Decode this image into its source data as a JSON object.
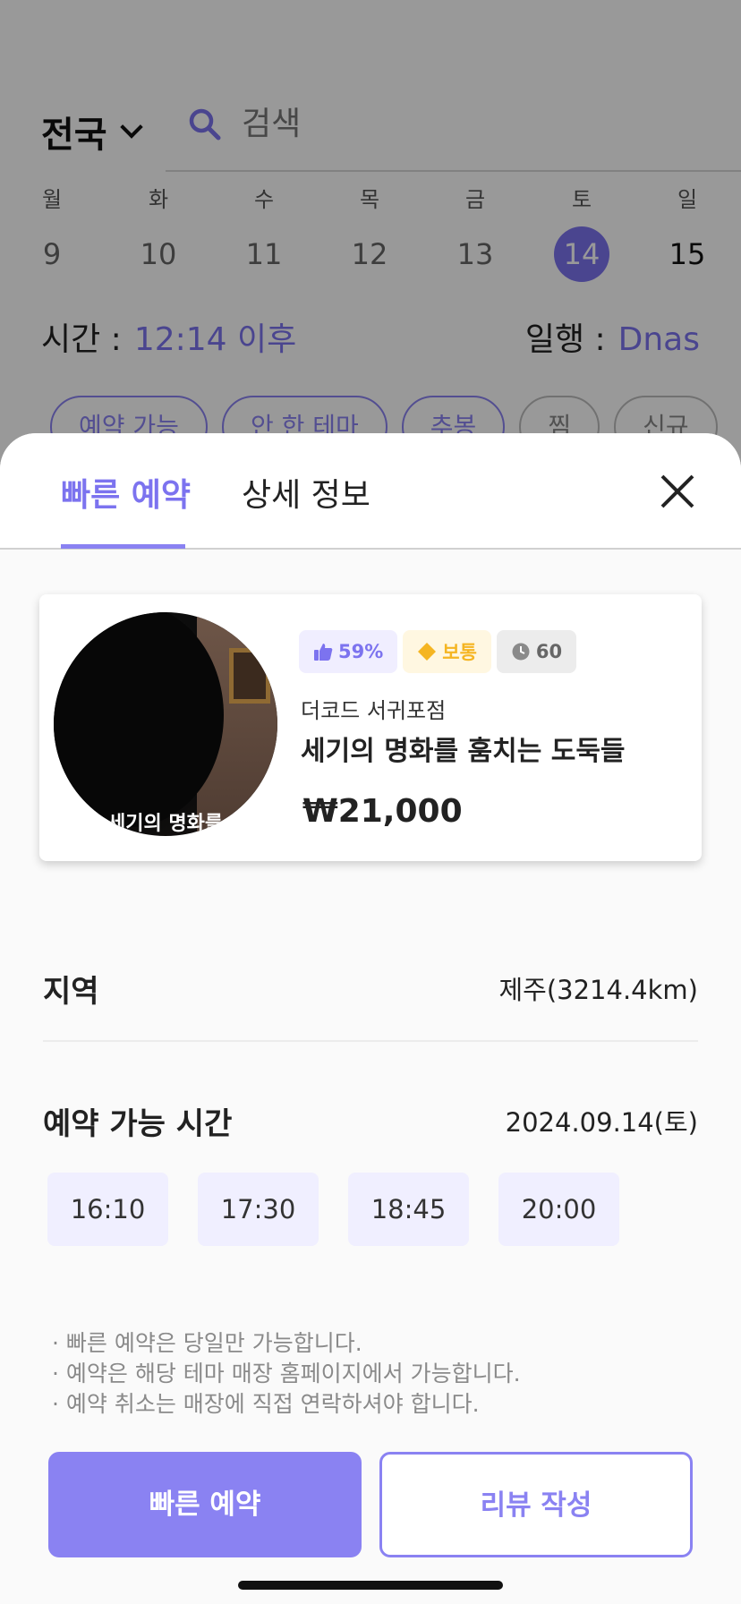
{
  "header": {
    "region": "전국",
    "search_placeholder": "검색"
  },
  "calendar": {
    "days": [
      {
        "name": "월",
        "date": "9"
      },
      {
        "name": "화",
        "date": "10"
      },
      {
        "name": "수",
        "date": "11"
      },
      {
        "name": "목",
        "date": "12"
      },
      {
        "name": "금",
        "date": "13"
      },
      {
        "name": "토",
        "date": "14",
        "selected": true
      },
      {
        "name": "일",
        "date": "15"
      }
    ]
  },
  "filters": {
    "time_label": "시간 :",
    "time_value": "12:14 이후",
    "party_label": "일행 :",
    "party_value": "Dnas",
    "chips": [
      "예약 가능",
      "안 한 테마",
      "추봉",
      "찜",
      "신규"
    ]
  },
  "sheet": {
    "tabs": [
      {
        "label": "빠른 예약",
        "active": true
      },
      {
        "label": "상세 정보",
        "active": false
      }
    ],
    "card": {
      "thumbnail_caption": "세기의 명화를",
      "badges": {
        "like": "59%",
        "level": "보통",
        "duration": "60"
      },
      "store_name": "더코드 서귀포점",
      "theme_name": "세기의 명화를 훔치는 도둑들",
      "price": "₩21,000"
    },
    "region_label": "지역",
    "region_value": "제주(3214.4km)",
    "availability_label": "예약 가능 시간",
    "availability_date": "2024.09.14(토)",
    "slots": [
      "16:10",
      "17:30",
      "18:45",
      "20:00"
    ],
    "notes": [
      "· 빠른 예약은 당일만 가능합니다.",
      "· 예약은 해당 테마 매장 홈페이지에서 가능합니다.",
      "· 예약 취소는 매장에 직접 연락하셔야 합니다."
    ],
    "primary_button": "빠른 예약",
    "secondary_button": "리뷰 작성"
  },
  "colors": {
    "accent": "#8a82f2",
    "accent_dark": "#7c73ef",
    "level_badge": "#f5b522"
  }
}
